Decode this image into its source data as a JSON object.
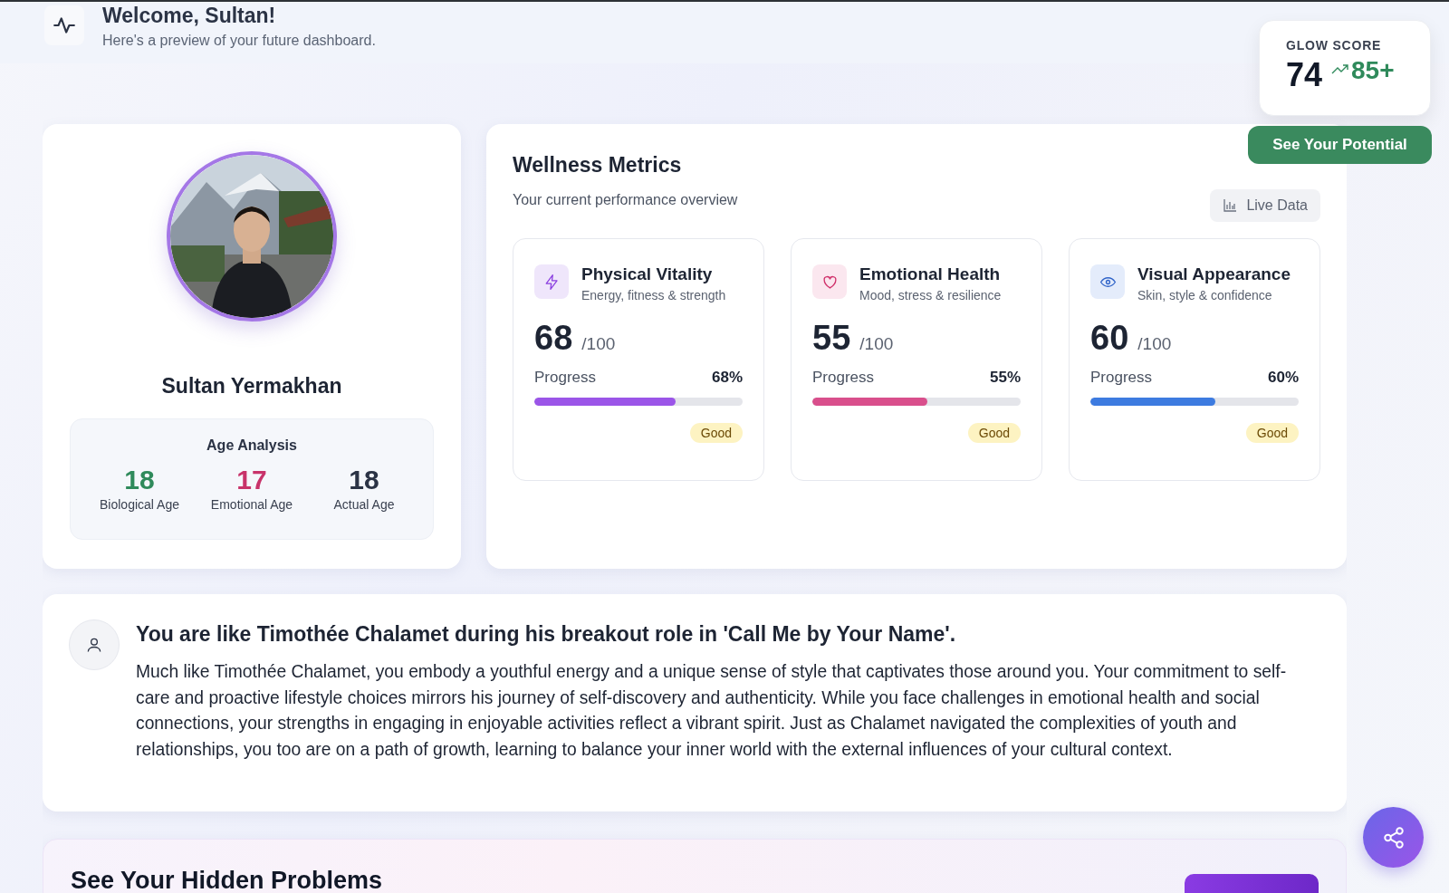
{
  "header": {
    "title": "Welcome, Sultan!",
    "subtitle": "Here's a preview of your future dashboard."
  },
  "glow_score": {
    "label": "GLOW SCORE",
    "current": "74",
    "potential": "85+",
    "button": "See Your Potential"
  },
  "profile": {
    "name": "Sultan Yermakhan",
    "age_analysis": {
      "title": "Age Analysis",
      "items": [
        {
          "value": "18",
          "label": "Biological Age",
          "color": "#2f8a5b"
        },
        {
          "value": "17",
          "label": "Emotional Age",
          "color": "#c8336a"
        },
        {
          "value": "18",
          "label": "Actual Age",
          "color": "#2b3345"
        }
      ]
    }
  },
  "wellness": {
    "title": "Wellness Metrics",
    "subtitle": "Your current performance overview",
    "badge": "Live Data",
    "metrics": [
      {
        "kind": "bolt",
        "title": "Physical Vitality",
        "subtitle": "Energy, fitness & strength",
        "score": "68",
        "max": "/100",
        "progress_label": "Progress",
        "reading": "68%",
        "level": 0.68,
        "color": "#9b55e8",
        "status": "Good"
      },
      {
        "kind": "heart",
        "title": "Emotional Health",
        "subtitle": "Mood, stress & resilience",
        "score": "55",
        "max": "/100",
        "progress_label": "Progress",
        "reading": "55%",
        "level": 0.55,
        "color": "#d94f8c",
        "status": "Good"
      },
      {
        "kind": "eye",
        "title": "Visual Appearance",
        "subtitle": "Skin, style & confidence",
        "score": "60",
        "max": "/100",
        "progress_label": "Progress",
        "reading": "60%",
        "level": 0.6,
        "color": "#3d7be0",
        "status": "Good"
      }
    ]
  },
  "comparison": {
    "title": "You are like Timothée Chalamet during his breakout role in 'Call Me by Your Name'.",
    "text": "Much like Timothée Chalamet, you embody a youthful energy and a unique sense of style that captivates those around you. Your commitment to self-care and proactive lifestyle choices mirrors his journey of self-discovery and authenticity. While you face challenges in emotional health and social connections, your strengths in engaging in enjoyable activities reflect a vibrant spirit. Just as Chalamet navigated the complexities of youth and relationships, you too are on a path of growth, learning to balance your inner world with the external influences of your cultural context."
  },
  "hidden_problems": {
    "title": "See Your Hidden Problems"
  }
}
